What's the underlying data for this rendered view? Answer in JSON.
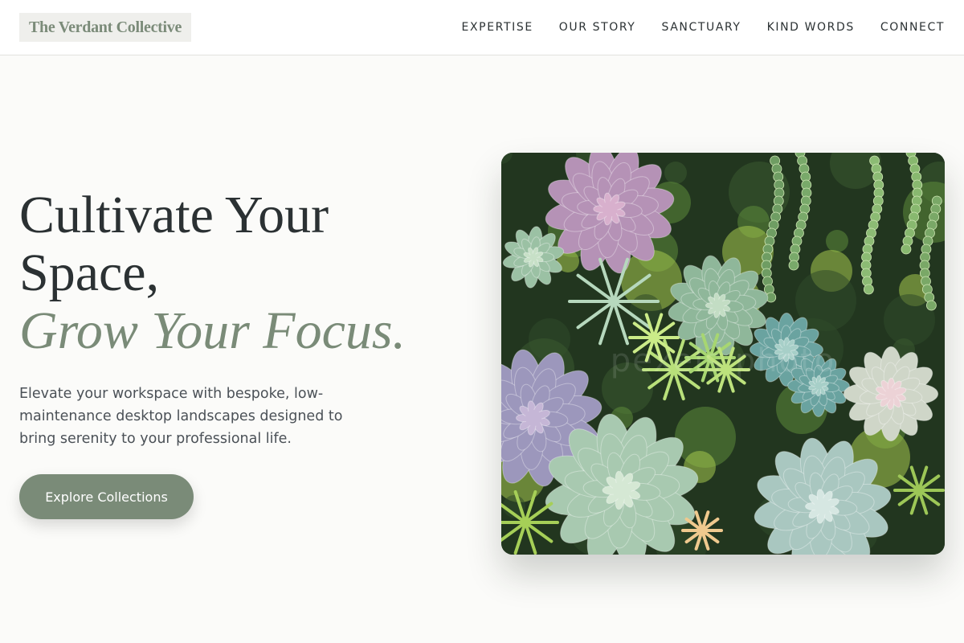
{
  "brand": {
    "name": "The Verdant Collective"
  },
  "nav": {
    "items": [
      "EXPERTISE",
      "OUR STORY",
      "SANCTUARY",
      "KIND WORDS",
      "CONNECT"
    ]
  },
  "hero": {
    "headline_line1": "Cultivate Your",
    "headline_line2": "Space,",
    "headline_accent": "Grow Your Focus.",
    "subtext": "Elevate your workspace with bespoke, low-maintenance desktop landscapes designed to bring serenity to your professional life.",
    "cta_label": "Explore Collections"
  },
  "image": {
    "subject": "succulent-arrangement",
    "watermark": "pexels photo"
  },
  "colors": {
    "accent": "#7a8b78",
    "text": "#2b3133",
    "background": "#fbfbf9",
    "logo_bg": "#efefec"
  }
}
